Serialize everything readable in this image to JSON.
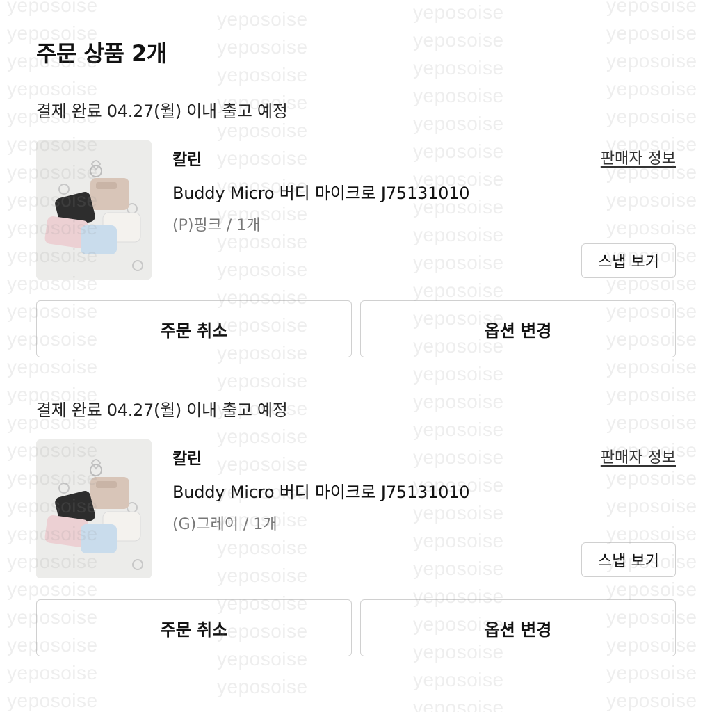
{
  "page_title": "주문 상품 2개",
  "watermark_text": "yeposoise",
  "orders": [
    {
      "ship_notice": "결제 완료 04.27(월) 이내 출고 예정",
      "brand": "칼린",
      "seller_link": "판매자 정보",
      "product_name": "Buddy Micro 버디 마이크로 J75131010",
      "option": "(P)핑크 / 1개",
      "snap_label": "스냅 보기",
      "cancel_label": "주문 취소",
      "change_option_label": "옵션 변경"
    },
    {
      "ship_notice": "결제 완료 04.27(월) 이내 출고 예정",
      "brand": "칼린",
      "seller_link": "판매자 정보",
      "product_name": "Buddy Micro 버디 마이크로 J75131010",
      "option": "(G)그레이 / 1개",
      "snap_label": "스냅 보기",
      "cancel_label": "주문 취소",
      "change_option_label": "옵션 변경"
    }
  ]
}
